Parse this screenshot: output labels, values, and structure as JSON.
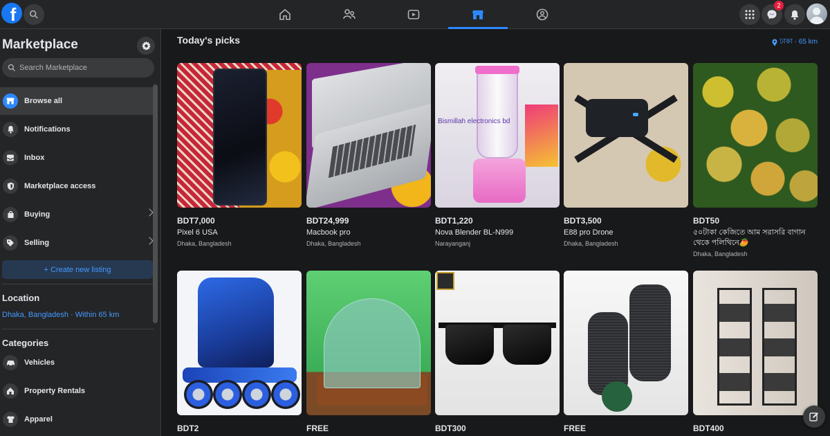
{
  "topbar": {
    "logo_letter": "f",
    "messenger_badge": "2"
  },
  "sidebar": {
    "title": "Marketplace",
    "search_placeholder": "Search Marketplace",
    "items": [
      {
        "label": "Browse all",
        "icon": "storefront-icon",
        "active": true
      },
      {
        "label": "Notifications",
        "icon": "bell-icon"
      },
      {
        "label": "Inbox",
        "icon": "inbox-icon"
      },
      {
        "label": "Marketplace access",
        "icon": "shield-icon"
      },
      {
        "label": "Buying",
        "icon": "shopping-bag-icon",
        "chevron": true
      },
      {
        "label": "Selling",
        "icon": "tag-icon",
        "chevron": true
      }
    ],
    "create_listing": "+ Create new listing",
    "location_heading": "Location",
    "location_value": "Dhaka, Bangladesh · Within 65 km",
    "categories_heading": "Categories",
    "categories": [
      {
        "label": "Vehicles",
        "icon": "car-icon"
      },
      {
        "label": "Property Rentals",
        "icon": "house-icon"
      },
      {
        "label": "Apparel",
        "icon": "shirt-icon"
      }
    ]
  },
  "main": {
    "title": "Today's picks",
    "location": "ঢাকা · 65 km",
    "listings": [
      {
        "price": "BDT7,000",
        "title": "Pixel 6 USA",
        "location": "Dhaka, Bangladesh"
      },
      {
        "price": "BDT24,999",
        "title": "Macbook pro",
        "location": "Dhaka, Bangladesh"
      },
      {
        "price": "BDT1,220",
        "title": "Nova Blender BL-N999",
        "location": "Narayanganj"
      },
      {
        "price": "BDT3,500",
        "title": "E88 pro Drone",
        "location": "Dhaka, Bangladesh"
      },
      {
        "price": "BDT50",
        "title": "৫০টাকা কেজিতে আম সরাসরি বাগান থেকে পলিথিনে🥭",
        "location": "Dhaka, Bangladesh"
      },
      {
        "price": "BDT2",
        "title": "",
        "location": ""
      },
      {
        "price": "FREE",
        "title": "",
        "location": ""
      },
      {
        "price": "BDT300",
        "title": "",
        "location": ""
      },
      {
        "price": "FREE",
        "title": "",
        "location": ""
      },
      {
        "price": "BDT400",
        "title": "",
        "location": ""
      }
    ],
    "blender_image_text": "Bismillah electronics bd"
  },
  "colors": {
    "accent": "#2d88ff",
    "link": "#4599ff",
    "background": "#18191a",
    "panel": "#242526"
  }
}
